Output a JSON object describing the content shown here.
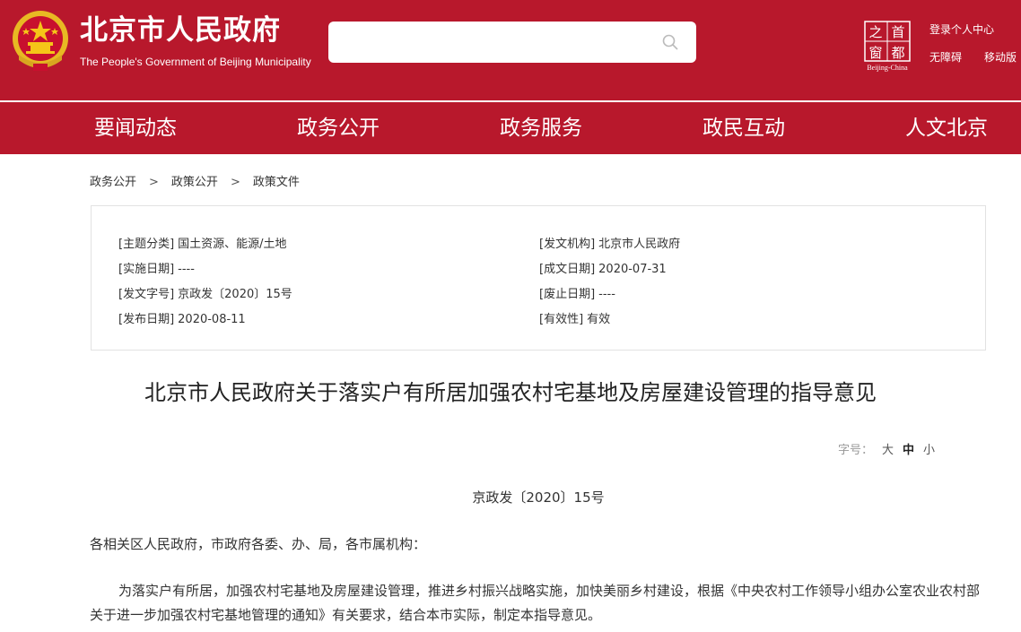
{
  "header": {
    "site_title": "北京市人民政府",
    "site_subtitle": "The People's Government of Beijing Municipality",
    "search": {
      "value": "",
      "placeholder": ""
    },
    "beijing_logo_chars": [
      "首",
      "都",
      "之",
      "窗"
    ],
    "beijing_logo_caption": "Beijing-China",
    "links": {
      "login": "登录个人中心",
      "accessibility": "无障碍",
      "mobile": "移动版"
    }
  },
  "nav": {
    "items": [
      {
        "label": "要闻动态"
      },
      {
        "label": "政务公开"
      },
      {
        "label": "政务服务"
      },
      {
        "label": "政民互动"
      },
      {
        "label": "人文北京"
      }
    ]
  },
  "breadcrumb": {
    "items": [
      {
        "label": "政务公开"
      },
      {
        "label": "政策公开"
      },
      {
        "label": "政策文件"
      }
    ],
    "separator": ">"
  },
  "meta": {
    "left": [
      {
        "key": "[主题分类]",
        "value": "国土资源、能源/土地"
      },
      {
        "key": "[实施日期]",
        "value": "----"
      },
      {
        "key": "[发文字号]",
        "value": "京政发〔2020〕15号"
      },
      {
        "key": "[发布日期]",
        "value": "2020-08-11"
      }
    ],
    "right": [
      {
        "key": "[发文机构]",
        "value": "北京市人民政府"
      },
      {
        "key": "[成文日期]",
        "value": "2020-07-31"
      },
      {
        "key": "[废止日期]",
        "value": "----"
      },
      {
        "key": "[有效性]",
        "value": "有效"
      }
    ]
  },
  "document": {
    "title": "北京市人民政府关于落实户有所居加强农村宅基地及房屋建设管理的指导意见",
    "font_size_label": "字号：",
    "font_sizes": [
      "大",
      "中",
      "小"
    ],
    "font_size_selected": "中",
    "doc_number": "京政发〔2020〕15号",
    "salutation": "各相关区人民政府，市政府各委、办、局，各市属机构：",
    "paragraph": "为落实户有所居，加强农村宅基地及房屋建设管理，推进乡村振兴战略实施，加快美丽乡村建设，根据《中央农村工作领导小组办公室农业农村部关于进一步加强农村宅基地管理的通知》有关要求，结合本市实际，制定本指导意见。"
  },
  "colors": {
    "brand_red": "#b8182c",
    "emblem_gold": "#f5c518"
  }
}
